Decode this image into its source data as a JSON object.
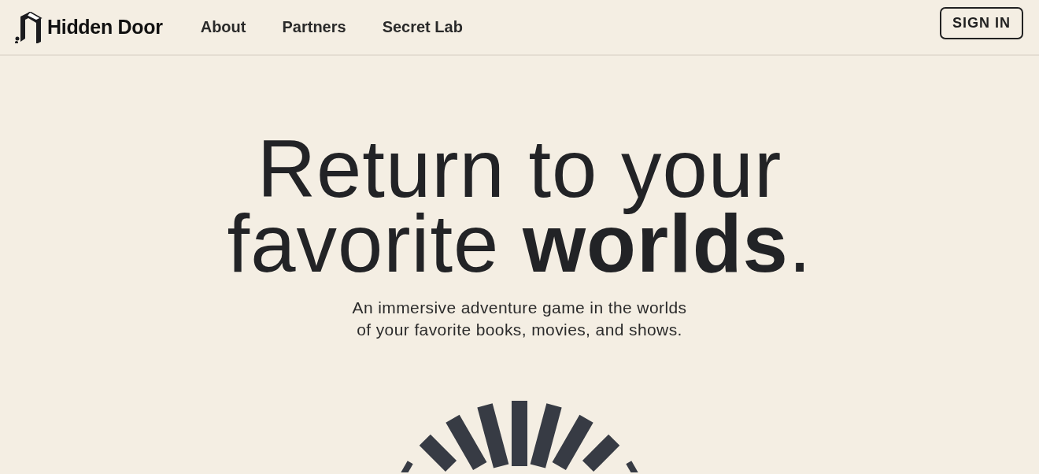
{
  "brand": {
    "name": "Hidden Door"
  },
  "nav": [
    {
      "label": "About"
    },
    {
      "label": "Partners"
    },
    {
      "label": "Secret Lab"
    }
  ],
  "sign_in": {
    "label": "SIGN IN"
  },
  "hero": {
    "title_lines": [
      "Return to your",
      "favorite **worlds**."
    ],
    "subtitle_lines": [
      "An immersive adventure game in the worlds",
      "of your favorite books, movies, and shows."
    ]
  }
}
